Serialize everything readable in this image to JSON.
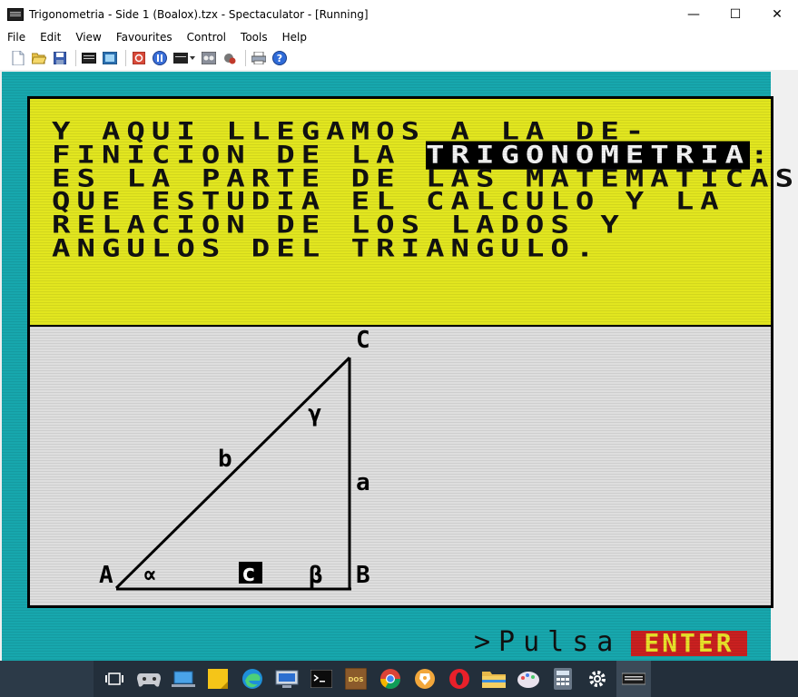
{
  "window": {
    "title": "Trigonometria - Side 1 (Boalox).tzx - Spectaculator - [Running]",
    "minimize_glyph": "—",
    "maximize_glyph": "☐",
    "close_glyph": "✕"
  },
  "menu": {
    "items": [
      "File",
      "Edit",
      "View",
      "Favourites",
      "Control",
      "Tools",
      "Help"
    ]
  },
  "toolbar": {
    "icons": [
      "new-icon",
      "open-icon",
      "save-icon",
      "keyboard-icon",
      "screenshot-icon",
      "reset-icon",
      "pause-icon",
      "joystick-keyboard-icon",
      "tape-icon",
      "tools-icon",
      "printer-icon",
      "help-icon"
    ]
  },
  "screen": {
    "text_lines": [
      {
        "before": "Y AQUI LLEGAMOS A LA DE-",
        "inverse": "",
        "after": ""
      },
      {
        "before": "FINICION DE LA ",
        "inverse": "TRIGONOMETRIA",
        "after": ":"
      },
      {
        "before": "ES LA PARTE DE LAS MATEMATICAS",
        "inverse": "",
        "after": ""
      },
      {
        "before": "QUE ESTUDIA EL CALCULO Y LA",
        "inverse": "",
        "after": ""
      },
      {
        "before": "RELACION DE LOS LADOS Y",
        "inverse": "",
        "after": ""
      },
      {
        "before": "ANGULOS DEL TRIANGULO.",
        "inverse": "",
        "after": ""
      }
    ],
    "diagram": {
      "vertex_labels": {
        "A": "A",
        "B": "B",
        "C": "C"
      },
      "side_labels": {
        "a": "a",
        "b": "b",
        "c": "c"
      },
      "angle_labels": {
        "alpha": "∝",
        "beta": "β",
        "gamma": "γ"
      }
    },
    "prompt": {
      "text": ">Pulsa",
      "key": "ENTER"
    },
    "colors": {
      "border": "#17a7ad",
      "text_panel": "#e2e61f",
      "diagram_panel": "#dedede",
      "enter_bg": "#c92020",
      "enter_fg": "#e8e22a"
    }
  },
  "taskbar": {
    "icons": [
      "task-view-icon",
      "gamepad-icon",
      "desktop-icon",
      "sticky-notes-icon",
      "edge-icon",
      "remote-desktop-icon",
      "terminal-icon",
      "dosbox-icon",
      "chrome-icon",
      "brave-icon",
      "opera-icon",
      "file-explorer-icon",
      "paint-icon",
      "calculator-icon",
      "settings-icon",
      "spectaculator-icon"
    ]
  }
}
